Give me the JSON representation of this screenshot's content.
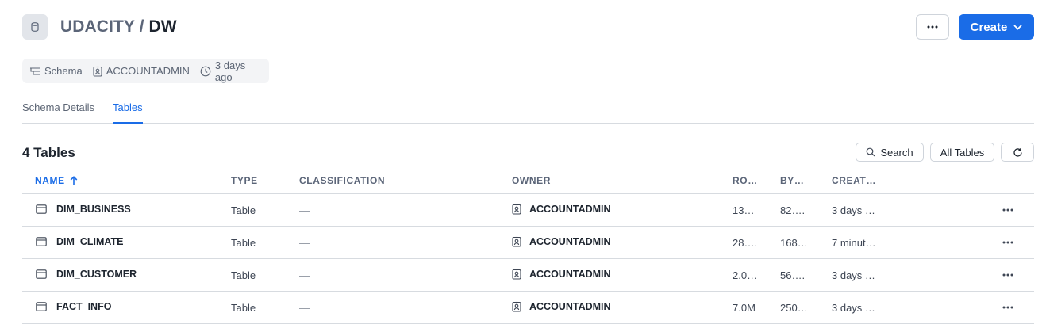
{
  "header": {
    "database": "UDACITY",
    "separator": " / ",
    "schema": "DW",
    "more_label": "…",
    "create_label": "Create"
  },
  "meta": {
    "type": "Schema",
    "owner": "ACCOUNTADMIN",
    "created": "3 days ago"
  },
  "tabs": [
    {
      "label": "Schema Details",
      "active": false
    },
    {
      "label": "Tables",
      "active": true
    }
  ],
  "list": {
    "count_label": "4 Tables",
    "search_label": "Search",
    "filter_label": "All Tables"
  },
  "columns": {
    "name": "NAME",
    "type": "TYPE",
    "classification": "CLASSIFICATION",
    "owner": "OWNER",
    "rows": "RO…",
    "bytes": "BY…",
    "created": "CREAT…"
  },
  "tables": [
    {
      "name": "DIM_BUSINESS",
      "type": "Table",
      "classification": "—",
      "owner": "ACCOUNTADMIN",
      "rows": "13…",
      "bytes": "82….",
      "created": "3 days …"
    },
    {
      "name": "DIM_CLIMATE",
      "type": "Table",
      "classification": "—",
      "owner": "ACCOUNTADMIN",
      "rows": "28….",
      "bytes": "168…",
      "created": "7 minut…"
    },
    {
      "name": "DIM_CUSTOMER",
      "type": "Table",
      "classification": "—",
      "owner": "ACCOUNTADMIN",
      "rows": "2.0…",
      "bytes": "56….",
      "created": "3 days …"
    },
    {
      "name": "FACT_INFO",
      "type": "Table",
      "classification": "—",
      "owner": "ACCOUNTADMIN",
      "rows": "7.0M",
      "bytes": "250…",
      "created": "3 days …"
    }
  ],
  "colors": {
    "accent": "#1a6ce7",
    "text": "#1e252f",
    "muted": "#5b6578",
    "border": "#d7dbe0"
  }
}
